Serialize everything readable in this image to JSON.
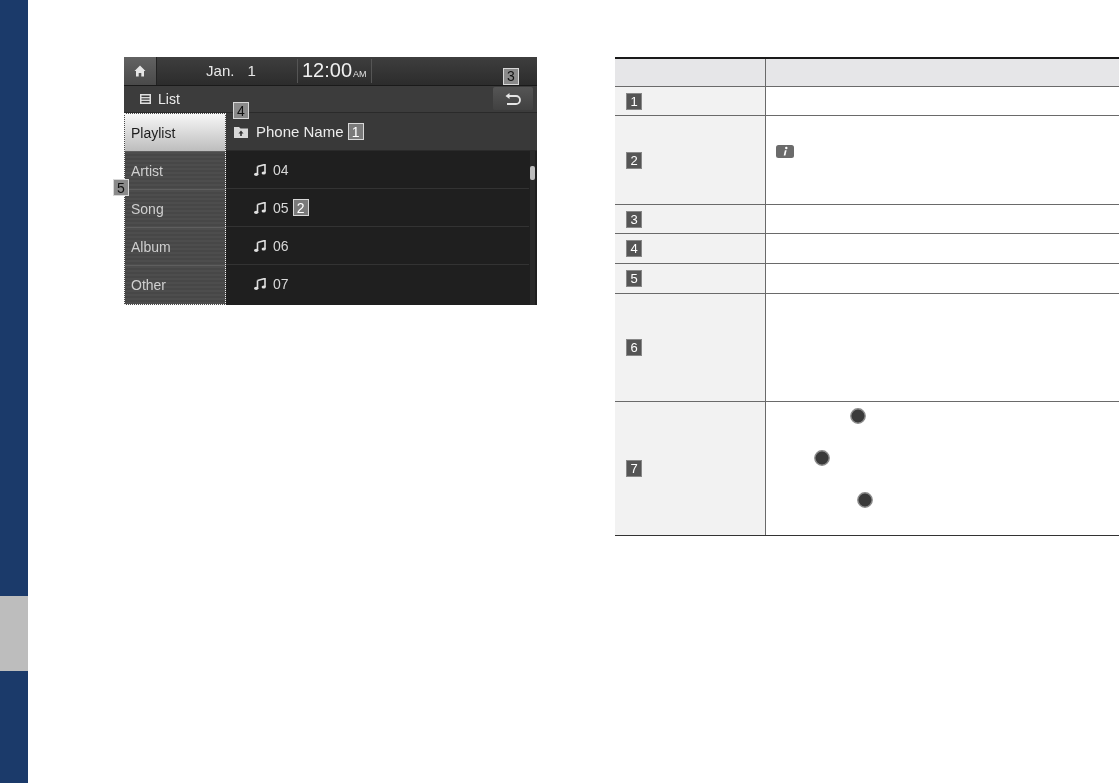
{
  "screen": {
    "date": "Jan. 1",
    "time": "12:00",
    "time_period": "AM",
    "title": "List",
    "back_callout": "3",
    "categories_callout": "5",
    "categories": [
      {
        "label": "Playlist",
        "selected": true
      },
      {
        "label": "Artist",
        "selected": false
      },
      {
        "label": "Song",
        "selected": false
      },
      {
        "label": "Album",
        "selected": false
      },
      {
        "label": "Other",
        "selected": false
      }
    ],
    "folder": {
      "up_callout": "4",
      "name": "Phone Name",
      "callout": "1"
    },
    "tracks": [
      {
        "title": "04"
      },
      {
        "title": "05",
        "callout": "2"
      },
      {
        "title": "06"
      },
      {
        "title": "07"
      }
    ]
  },
  "table": {
    "rows": [
      {
        "number": "1"
      },
      {
        "number": "2",
        "symbols": [
          {
            "kind": "info"
          }
        ]
      },
      {
        "number": "3"
      },
      {
        "number": "4"
      },
      {
        "number": "5"
      },
      {
        "number": "6"
      },
      {
        "number": "7",
        "symbols": [
          {
            "kind": "dot"
          },
          {
            "kind": "dot"
          },
          {
            "kind": "dot"
          }
        ]
      }
    ]
  }
}
